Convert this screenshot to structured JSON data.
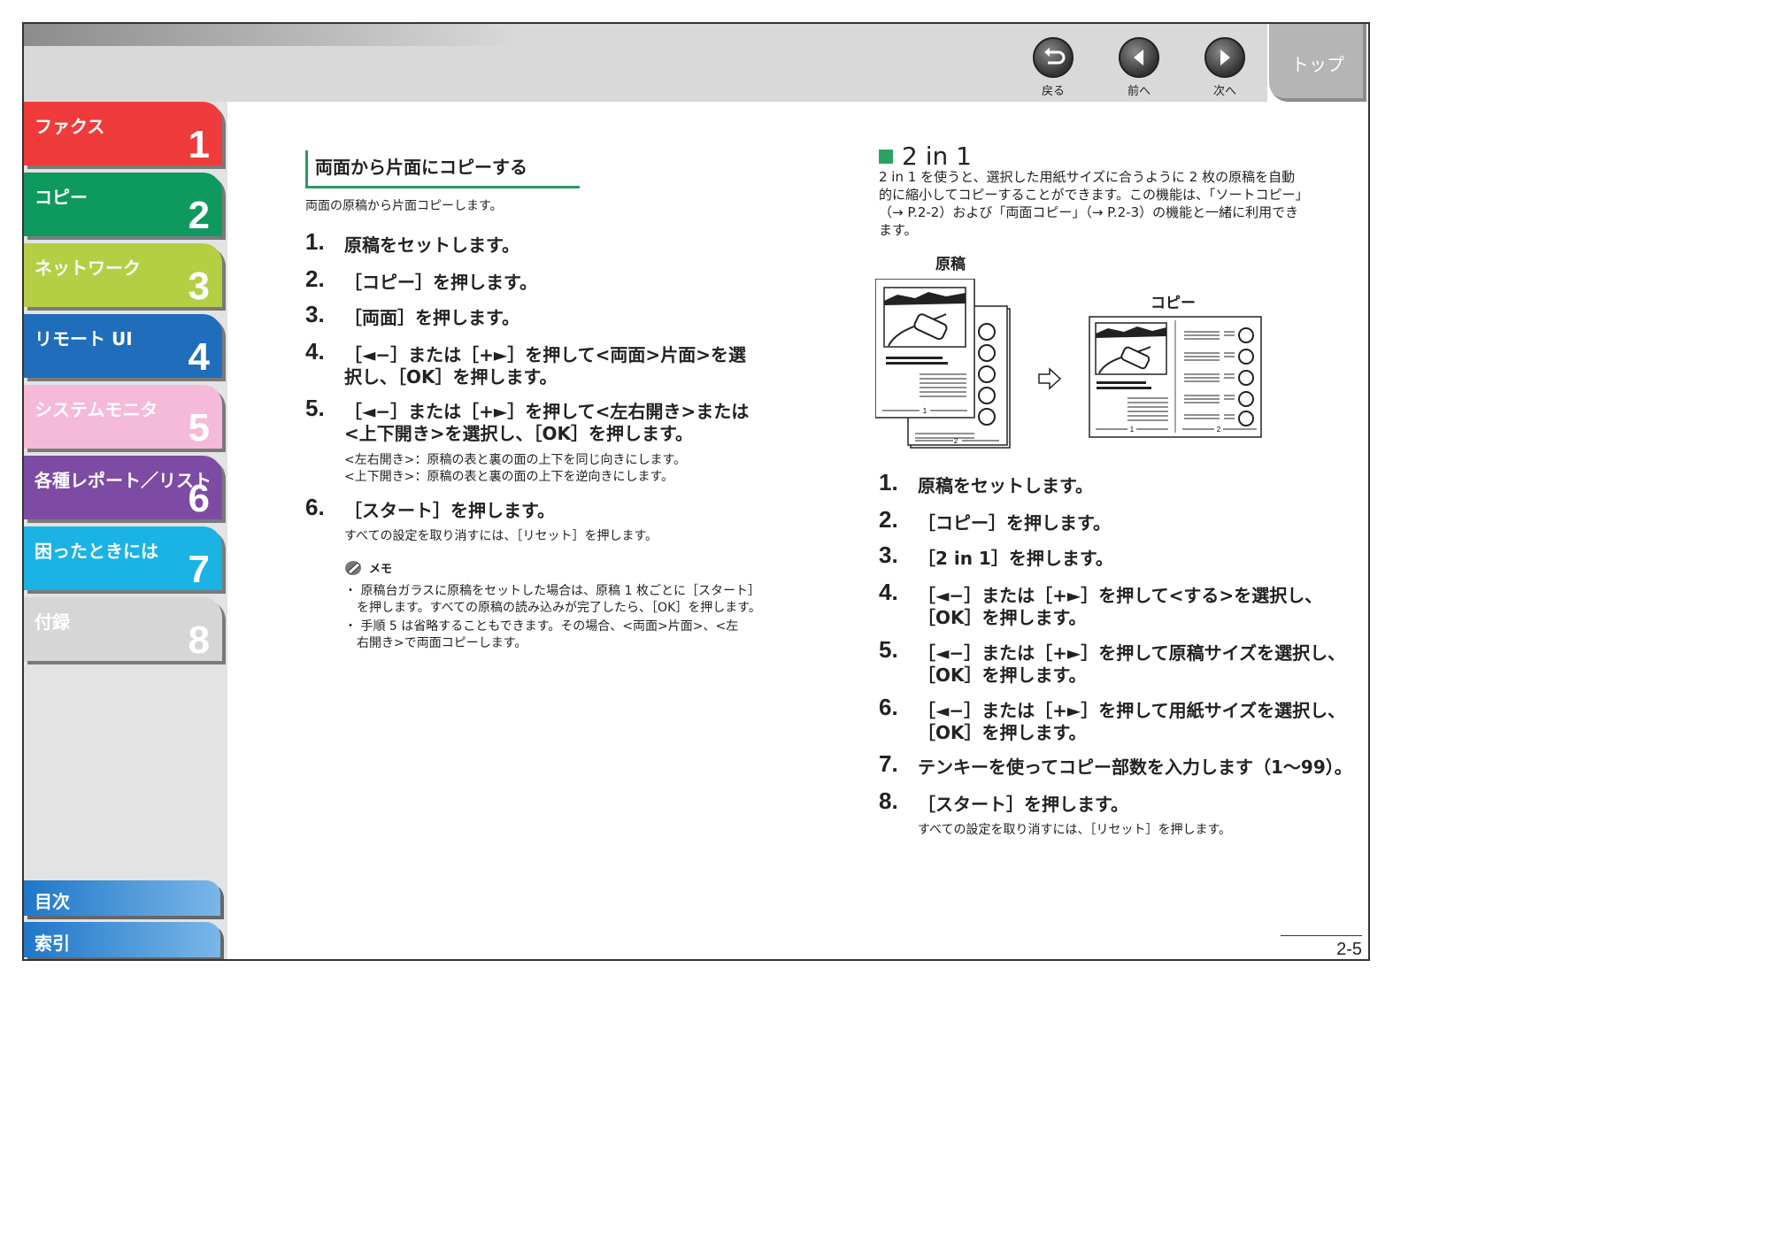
{
  "header": {
    "back": "戻る",
    "prev": "前へ",
    "next": "次へ",
    "top": "トップ"
  },
  "sidebar": {
    "chapters": [
      {
        "title": "ファクス",
        "num": "1",
        "color": "#ef3b3b"
      },
      {
        "title": "コピー",
        "num": "2",
        "color": "#0e9a5e"
      },
      {
        "title": "ネットワーク",
        "num": "3",
        "color": "#b5cf45"
      },
      {
        "title": "リモート UI",
        "num": "4",
        "color": "#1f6dbb"
      },
      {
        "title": "システムモニタ",
        "num": "5",
        "color": "#f5b9d9"
      },
      {
        "title": "各種レポート／リスト",
        "num": "6",
        "color": "#7d4ba3"
      },
      {
        "title": "困ったときには",
        "num": "7",
        "color": "#1ab3e3"
      },
      {
        "title": "付録",
        "num": "8",
        "color": "#d6d6d6"
      }
    ],
    "toc": "目次",
    "index": "索引"
  },
  "left": {
    "title": "両面から片面にコピーする",
    "intro": "両面の原稿から片面コピーします。",
    "steps": [
      {
        "num": "1.",
        "text": "原稿をセットします。"
      },
      {
        "num": "2.",
        "text": "［コピー］を押します。"
      },
      {
        "num": "3.",
        "text": "［両面］を押します。"
      },
      {
        "num": "4.",
        "line1": "［◄−］または［+►］を押して<両面>片面>を選",
        "line2": "択し、［OK］を押します。"
      },
      {
        "num": "5.",
        "line1": "［◄−］または［+►］を押して<左右開き>または",
        "line2": "<上下開き>を選択し、［OK］を押します。"
      },
      {
        "num": "6.",
        "text": "［スタート］を押します。"
      }
    ],
    "step5_notes": [
      "<左右開き>：原稿の表と裏の面の上下を同じ向きにします。",
      "<上下開き>：原稿の表と裏の面の上下を逆向きにします。"
    ],
    "step6_note": "すべての設定を取り消すには、［リセット］を押します。",
    "memo_label": "メモ",
    "memo_items": [
      {
        "line1": "・ 原稿台ガラスに原稿をセットした場合は、原稿 1 枚ごとに［スタート］",
        "line2": "を押します。すべての原稿の読み込みが完了したら、［OK］を押します。"
      },
      {
        "line1": "・ 手順 5 は省略することもできます。その場合、<両面>片面>、<左",
        "line2": "右開き>で両面コピーします。"
      }
    ]
  },
  "right": {
    "title": "2 in 1",
    "intro_lines": [
      "2 in 1 を使うと、選択した用紙サイズに合うように 2 枚の原稿を自動",
      "的に縮小してコピーすることができます。この機能は、「ソートコピー」",
      "（→ P.2-2）および「両面コピー」（→ P.2-3）の機能と一緒に利用でき",
      "ます。"
    ],
    "caption_original": "原稿",
    "caption_copy": "コピー",
    "fig_page1": "1",
    "fig_page2": "2",
    "steps": [
      {
        "num": "1.",
        "text": "原稿をセットします。"
      },
      {
        "num": "2.",
        "text": "［コピー］を押します。"
      },
      {
        "num": "3.",
        "text": "［2 in 1］を押します。"
      },
      {
        "num": "4.",
        "line1": "［◄−］または［+►］を押して<する>を選択し、",
        "line2": "［OK］を押します。"
      },
      {
        "num": "5.",
        "line1": "［◄−］または［+►］を押して原稿サイズを選択し、",
        "line2": "［OK］を押します。"
      },
      {
        "num": "6.",
        "line1": "［◄−］または［+►］を押して用紙サイズを選択し、",
        "line2": "［OK］を押します。"
      },
      {
        "num": "7.",
        "text": "テンキーを使ってコピー部数を入力します（1〜99）。"
      },
      {
        "num": "8.",
        "text": "［スタート］を押します。"
      }
    ],
    "step8_note": "すべての設定を取り消すには、［リセット］を押します。"
  },
  "page_number": "2-5"
}
